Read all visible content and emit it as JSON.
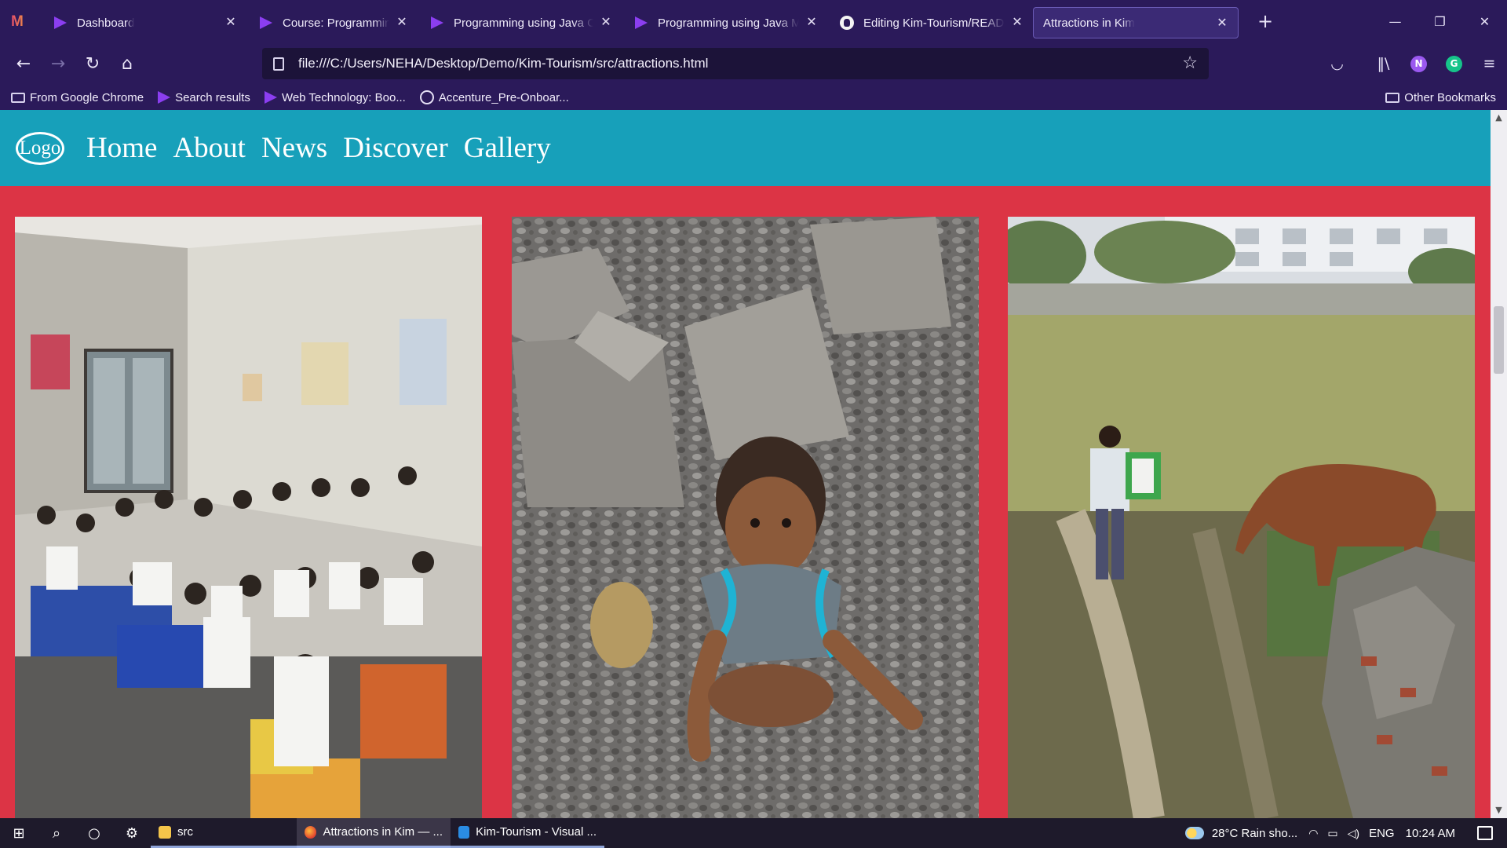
{
  "browser": {
    "tabs": [
      {
        "label": "Dashboard",
        "icon": "arrow-favicon"
      },
      {
        "label": "Course: Programming using Java",
        "icon": "arrow-favicon"
      },
      {
        "label": "Programming using Java Con",
        "icon": "arrow-favicon"
      },
      {
        "label": "Programming using Java Mo",
        "icon": "arrow-favicon"
      },
      {
        "label": "Editing Kim-Tourism/READM",
        "icon": "github-icon"
      },
      {
        "label": "Attractions in Kim",
        "icon": "none",
        "active": true
      }
    ],
    "address": "file:///C:/Users/NEHA/Desktop/Demo/Kim-Tourism/src/attractions.html",
    "profile_initial": "N",
    "extension_initial": "G",
    "bookmarks": [
      {
        "label": "From Google Chrome",
        "icon": "folder-icon"
      },
      {
        "label": "Search results",
        "icon": "arrow-favicon"
      },
      {
        "label": "Web Technology: Boo...",
        "icon": "arrow-favicon"
      },
      {
        "label": "Accenture_Pre-Onboar...",
        "icon": "github-icon"
      }
    ],
    "other_bookmarks": "Other Bookmarks",
    "accent": "#2b1a5a"
  },
  "site": {
    "logo": "Logo",
    "nav": [
      "Home",
      "About",
      "News",
      "Discover",
      "Gallery"
    ],
    "header_color": "#17a0ba",
    "background_color": "#dc3445"
  },
  "taskbar": {
    "apps": [
      {
        "label": "src",
        "icon": "folder-icon"
      },
      {
        "label": "Attractions in Kim — ...",
        "icon": "firefox-icon"
      },
      {
        "label": "Kim-Tourism - Visual ...",
        "icon": "vscode-icon"
      }
    ],
    "weather": "28°C  Rain sho...",
    "language": "ENG",
    "time": "10:24 AM"
  }
}
